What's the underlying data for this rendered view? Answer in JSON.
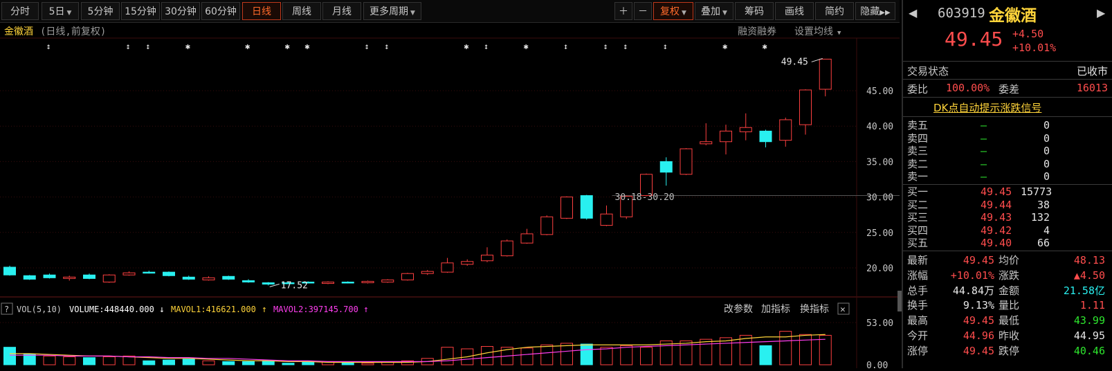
{
  "toolbar": {
    "periods": [
      "分时",
      "5日",
      "5分钟",
      "15分钟",
      "30分钟",
      "60分钟",
      "日线",
      "周线",
      "月线",
      "更多周期"
    ],
    "active": "日线",
    "right_buttons": [
      "复权",
      "叠加",
      "筹码",
      "画线",
      "简约",
      "隐藏"
    ]
  },
  "chart": {
    "title": "金徽酒",
    "subtitle": "(日线,前复权)",
    "links": [
      "融资融券",
      "设置均线"
    ],
    "y_labels": [
      "45.00",
      "40.00",
      "35.00",
      "30.00",
      "25.00",
      "20.00"
    ],
    "high_annotation": "49.45",
    "low_annotation": "17.52",
    "range_annotation": "30.18-30.20"
  },
  "chart_data": {
    "type": "candlestick",
    "ylim": [
      16.5,
      50
    ],
    "candles": [
      {
        "o": 19.0,
        "c": 20.1,
        "h": 20.3,
        "l": 18.9,
        "up": false
      },
      {
        "o": 18.4,
        "c": 18.9,
        "h": 19.0,
        "l": 18.3,
        "up": false
      },
      {
        "o": 18.6,
        "c": 19.0,
        "h": 19.2,
        "l": 18.5,
        "up": false
      },
      {
        "o": 18.5,
        "c": 18.7,
        "h": 18.9,
        "l": 18.2,
        "up": true
      },
      {
        "o": 18.5,
        "c": 19.0,
        "h": 19.2,
        "l": 18.4,
        "up": false
      },
      {
        "o": 18.0,
        "c": 19.0,
        "h": 19.1,
        "l": 17.9,
        "up": true
      },
      {
        "o": 19.0,
        "c": 19.3,
        "h": 19.5,
        "l": 18.9,
        "up": true
      },
      {
        "o": 19.3,
        "c": 19.4,
        "h": 19.6,
        "l": 19.2,
        "up": false
      },
      {
        "o": 18.9,
        "c": 19.4,
        "h": 19.5,
        "l": 18.8,
        "up": false
      },
      {
        "o": 18.4,
        "c": 18.7,
        "h": 18.9,
        "l": 18.3,
        "up": false
      },
      {
        "o": 18.3,
        "c": 18.6,
        "h": 18.8,
        "l": 18.2,
        "up": true
      },
      {
        "o": 18.4,
        "c": 18.8,
        "h": 18.9,
        "l": 18.3,
        "up": false
      },
      {
        "o": 18.0,
        "c": 18.2,
        "h": 18.4,
        "l": 17.9,
        "up": false
      },
      {
        "o": 17.7,
        "c": 17.9,
        "h": 18.0,
        "l": 17.52,
        "up": false
      },
      {
        "o": 17.8,
        "c": 17.9,
        "h": 18.0,
        "l": 17.7,
        "up": false
      },
      {
        "o": 17.9,
        "c": 18.0,
        "h": 18.1,
        "l": 17.8,
        "up": false
      },
      {
        "o": 17.8,
        "c": 18.0,
        "h": 18.1,
        "l": 17.7,
        "up": true
      },
      {
        "o": 17.9,
        "c": 18.0,
        "h": 18.1,
        "l": 17.8,
        "up": false
      },
      {
        "o": 17.9,
        "c": 18.1,
        "h": 18.2,
        "l": 17.8,
        "up": true
      },
      {
        "o": 18.0,
        "c": 18.3,
        "h": 18.4,
        "l": 17.9,
        "up": true
      },
      {
        "o": 18.3,
        "c": 19.2,
        "h": 19.3,
        "l": 18.2,
        "up": true
      },
      {
        "o": 19.2,
        "c": 19.5,
        "h": 19.7,
        "l": 19.0,
        "up": true
      },
      {
        "o": 19.4,
        "c": 20.7,
        "h": 21.4,
        "l": 19.3,
        "up": true
      },
      {
        "o": 20.5,
        "c": 20.9,
        "h": 21.2,
        "l": 20.3,
        "up": true
      },
      {
        "o": 21.0,
        "c": 21.8,
        "h": 22.9,
        "l": 20.8,
        "up": true
      },
      {
        "o": 21.7,
        "c": 23.8,
        "h": 24.0,
        "l": 21.6,
        "up": true
      },
      {
        "o": 23.5,
        "c": 24.8,
        "h": 25.5,
        "l": 23.4,
        "up": true
      },
      {
        "o": 24.7,
        "c": 27.2,
        "h": 27.4,
        "l": 24.6,
        "up": true
      },
      {
        "o": 27.0,
        "c": 30.0,
        "h": 30.1,
        "l": 26.9,
        "up": true
      },
      {
        "o": 30.2,
        "c": 27.0,
        "h": 30.3,
        "l": 26.8,
        "up": false
      },
      {
        "o": 26.0,
        "c": 27.6,
        "h": 28.8,
        "l": 25.9,
        "up": true
      },
      {
        "o": 27.2,
        "c": 30.1,
        "h": 30.2,
        "l": 26.9,
        "up": true
      },
      {
        "o": 30.2,
        "c": 33.2,
        "h": 33.3,
        "l": 30.1,
        "up": true
      },
      {
        "o": 35.0,
        "c": 33.5,
        "h": 35.6,
        "l": 31.6,
        "up": false
      },
      {
        "o": 33.2,
        "c": 36.8,
        "h": 36.9,
        "l": 33.1,
        "up": true
      },
      {
        "o": 37.5,
        "c": 37.8,
        "h": 40.4,
        "l": 37.3,
        "up": true
      },
      {
        "o": 37.8,
        "c": 39.3,
        "h": 40.2,
        "l": 36.0,
        "up": true
      },
      {
        "o": 39.2,
        "c": 39.8,
        "h": 41.8,
        "l": 38.0,
        "up": true
      },
      {
        "o": 39.3,
        "c": 37.8,
        "h": 39.5,
        "l": 37.0,
        "up": false
      },
      {
        "o": 38.0,
        "c": 40.9,
        "h": 41.2,
        "l": 37.1,
        "up": true
      },
      {
        "o": 40.2,
        "c": 45.1,
        "h": 45.2,
        "l": 38.8,
        "up": true
      },
      {
        "o": 45.2,
        "c": 49.45,
        "h": 49.45,
        "l": 44.2,
        "up": true
      }
    ],
    "volume": {
      "title": "VOL(5,10)",
      "volume_label": "VOLUME:448440.000",
      "mavol1_label": "MAVOL1:416621.000",
      "mavol2_label": "MAVOL2:397145.700",
      "y_labels": [
        "53.00",
        "0.00"
      ],
      "ylim": [
        0,
        53
      ],
      "values": [
        22,
        13,
        11,
        10,
        9,
        10,
        11,
        5,
        6,
        7,
        5,
        4,
        4,
        5,
        2,
        3,
        4,
        3,
        2,
        3,
        5,
        8,
        22,
        20,
        23,
        22,
        21,
        25,
        27,
        26,
        22,
        24,
        22,
        30,
        30,
        32,
        34,
        37,
        24,
        42,
        38,
        37
      ],
      "up": [
        false,
        false,
        true,
        true,
        false,
        true,
        true,
        false,
        false,
        false,
        true,
        false,
        false,
        false,
        false,
        false,
        true,
        false,
        true,
        true,
        true,
        true,
        true,
        true,
        true,
        true,
        true,
        true,
        true,
        false,
        true,
        true,
        true,
        true,
        true,
        true,
        true,
        true,
        false,
        true,
        true,
        true
      ],
      "mavol1": [
        14,
        14,
        13,
        12,
        11,
        11,
        10,
        9,
        8,
        8,
        7,
        6,
        5,
        5,
        4,
        4,
        3,
        3,
        3,
        3,
        3,
        4,
        7,
        10,
        15,
        19,
        22,
        23,
        24,
        25,
        25,
        25,
        25,
        26,
        27,
        29,
        30,
        33,
        35,
        35,
        37,
        38
      ],
      "mavol2": [
        12,
        12,
        12,
        11,
        11,
        11,
        10,
        10,
        9,
        9,
        8,
        8,
        7,
        6,
        5,
        5,
        4,
        4,
        4,
        4,
        4,
        4,
        5,
        7,
        9,
        11,
        13,
        15,
        17,
        19,
        20,
        22,
        23,
        24,
        25,
        26,
        27,
        28,
        29,
        30,
        31,
        32
      ]
    },
    "vol_buttons": [
      "改参数",
      "加指标",
      "换指标"
    ]
  },
  "panel": {
    "code": "603919",
    "name": "金徽酒",
    "price": "49.45",
    "change": "+4.50",
    "change_pct": "+10.01%",
    "status_label": "交易状态",
    "status_value": "已收市",
    "weibi_label": "委比",
    "weibi_value": "100.00%",
    "weicha_label": "委差",
    "weicha_value": "16013",
    "signal_link": "DK点自动提示涨跌信号",
    "sell": [
      {
        "label": "卖五",
        "price": "—",
        "vol": "0"
      },
      {
        "label": "卖四",
        "price": "—",
        "vol": "0"
      },
      {
        "label": "卖三",
        "price": "—",
        "vol": "0"
      },
      {
        "label": "卖二",
        "price": "—",
        "vol": "0"
      },
      {
        "label": "卖一",
        "price": "—",
        "vol": "0"
      }
    ],
    "buy": [
      {
        "label": "买一",
        "price": "49.45",
        "vol": "15773"
      },
      {
        "label": "买二",
        "price": "49.44",
        "vol": "38"
      },
      {
        "label": "买三",
        "price": "49.43",
        "vol": "132"
      },
      {
        "label": "买四",
        "price": "49.42",
        "vol": "4"
      },
      {
        "label": "买五",
        "price": "49.40",
        "vol": "66"
      }
    ],
    "stats": [
      {
        "l1": "最新",
        "v1": "49.45",
        "c1": "red",
        "l2": "均价",
        "v2": "48.13",
        "c2": "red"
      },
      {
        "l1": "涨幅",
        "v1": "+10.01%",
        "c1": "red",
        "l2": "涨跌",
        "v2": "▲4.50",
        "c2": "red"
      },
      {
        "l1": "总手",
        "v1": "44.84万",
        "c1": "white",
        "l2": "金额",
        "v2": "21.58亿",
        "c2": "cyan"
      },
      {
        "l1": "换手",
        "v1": "9.13%",
        "c1": "white",
        "l2": "量比",
        "v2": "1.11",
        "c2": "red"
      },
      {
        "l1": "最高",
        "v1": "49.45",
        "c1": "red",
        "l2": "最低",
        "v2": "43.99",
        "c2": "green"
      },
      {
        "l1": "今开",
        "v1": "44.96",
        "c1": "red",
        "l2": "昨收",
        "v2": "44.95",
        "c2": "white"
      },
      {
        "l1": "涨停",
        "v1": "49.45",
        "c1": "red",
        "l2": "跌停",
        "v2": "40.46",
        "c2": "green"
      }
    ]
  },
  "colors": {
    "up": "#ff4040",
    "down": "#29f0f0",
    "ma1": "#ffd43a",
    "ma2": "#ff3ef0",
    "grid": "#3a0d0d"
  }
}
